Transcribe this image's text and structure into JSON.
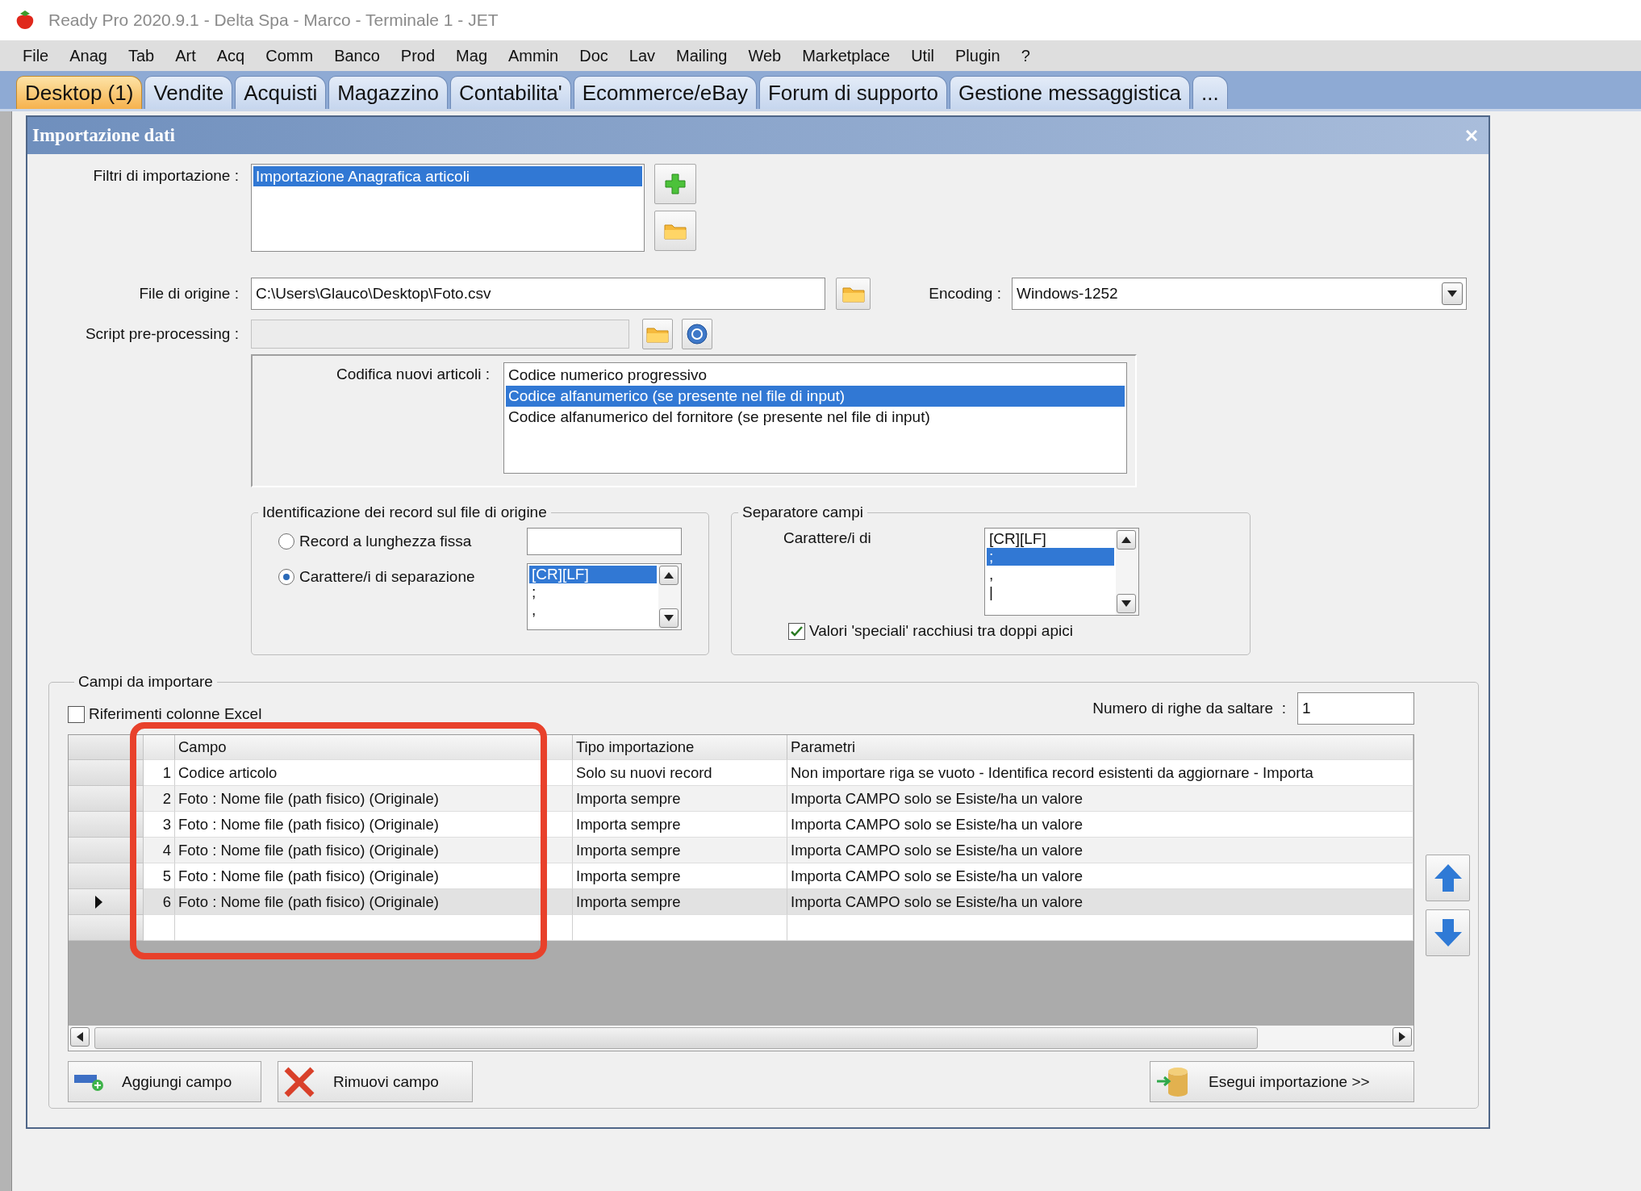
{
  "window": {
    "title": "Ready Pro 2020.9.1 - Delta Spa - Marco - Terminale 1 - JET"
  },
  "menu": [
    "File",
    "Anag",
    "Tab",
    "Art",
    "Acq",
    "Comm",
    "Banco",
    "Prod",
    "Mag",
    "Ammin",
    "Doc",
    "Lav",
    "Mailing",
    "Web",
    "Marketplace",
    "Util",
    "Plugin",
    "?"
  ],
  "tabs": [
    {
      "label": "Desktop (1)",
      "selected": true
    },
    {
      "label": "Vendite",
      "selected": false
    },
    {
      "label": "Acquisti",
      "selected": false
    },
    {
      "label": "Magazzino",
      "selected": false
    },
    {
      "label": "Contabilita'",
      "selected": false
    },
    {
      "label": "Ecommerce/eBay",
      "selected": false
    },
    {
      "label": "Forum di supporto",
      "selected": false
    },
    {
      "label": "Gestione messaggistica",
      "selected": false
    },
    {
      "label": "...",
      "selected": false
    }
  ],
  "dialog": {
    "title": "Importazione dati"
  },
  "filters": {
    "label": "Filtri di importazione :",
    "items": [
      {
        "label": "Importazione Anagrafica articoli",
        "selected": true
      }
    ]
  },
  "source_file": {
    "label": "File di origine :",
    "value": "C:\\Users\\Glauco\\Desktop\\Foto.csv"
  },
  "encoding": {
    "label": "Encoding :",
    "value": "Windows-1252"
  },
  "script": {
    "label": "Script pre-processing :",
    "disabled": true
  },
  "coding": {
    "label": "Codifica nuovi articoli :",
    "options": [
      {
        "label": "Codice numerico progressivo",
        "selected": false
      },
      {
        "label": "Codice alfanumerico (se presente nel file di input)",
        "selected": true
      },
      {
        "label": "Codice alfanumerico del fornitore (se presente nel file di input)",
        "selected": false
      }
    ]
  },
  "identification": {
    "title": "Identificazione dei record sul file di origine",
    "options": [
      {
        "label": "Record a lunghezza fissa",
        "selected": false
      },
      {
        "label": "Carattere/i di separazione",
        "selected": true
      }
    ],
    "separators": [
      {
        "label": "[CR][LF]",
        "selected": true
      },
      {
        "label": ";",
        "selected": false
      },
      {
        "label": ",",
        "selected": false
      }
    ]
  },
  "field_separator": {
    "title": "Separatore campi",
    "label": "Carattere/i di",
    "separators": [
      {
        "label": "[CR][LF]",
        "selected": false
      },
      {
        "label": ";",
        "selected": true
      },
      {
        "label": ",",
        "selected": false
      },
      {
        "label": "|",
        "selected": false
      }
    ],
    "quoted": {
      "label": "Valori 'speciali' racchiusi tra doppi apici",
      "checked": true
    }
  },
  "fields": {
    "title": "Campi da importare",
    "excel_refs": {
      "label": "Riferimenti colonne Excel",
      "checked": false
    },
    "skip_rows": {
      "label": "Numero di righe da saltare  :",
      "value": "1"
    },
    "columns": [
      "Campo",
      "Tipo importazione",
      "Parametri"
    ],
    "rows": [
      {
        "number": "1",
        "campo": "Codice articolo",
        "tipo": "Solo su nuovi record",
        "parametri": "Non importare riga se vuoto - Identifica record esistenti da aggiornare - Importa",
        "selected": false
      },
      {
        "number": "2",
        "campo": "Foto : Nome file (path fisico) (Originale)",
        "tipo": "Importa sempre",
        "parametri": "Importa CAMPO solo se Esiste/ha un valore",
        "selected": false
      },
      {
        "number": "3",
        "campo": "Foto : Nome file (path fisico) (Originale)",
        "tipo": "Importa sempre",
        "parametri": "Importa CAMPO solo se Esiste/ha un valore",
        "selected": false
      },
      {
        "number": "4",
        "campo": "Foto : Nome file (path fisico) (Originale)",
        "tipo": "Importa sempre",
        "parametri": "Importa CAMPO solo se Esiste/ha un valore",
        "selected": false
      },
      {
        "number": "5",
        "campo": "Foto : Nome file (path fisico) (Originale)",
        "tipo": "Importa sempre",
        "parametri": "Importa CAMPO solo se Esiste/ha un valore",
        "selected": false
      },
      {
        "number": "6",
        "campo": "Foto : Nome file (path fisico) (Originale)",
        "tipo": "Importa sempre",
        "parametri": "Importa CAMPO solo se Esiste/ha un valore",
        "selected": true
      }
    ]
  },
  "buttons": {
    "add": "Aggiungi campo",
    "remove": "Rimuovi campo",
    "run": "Esegui importazione >>"
  }
}
